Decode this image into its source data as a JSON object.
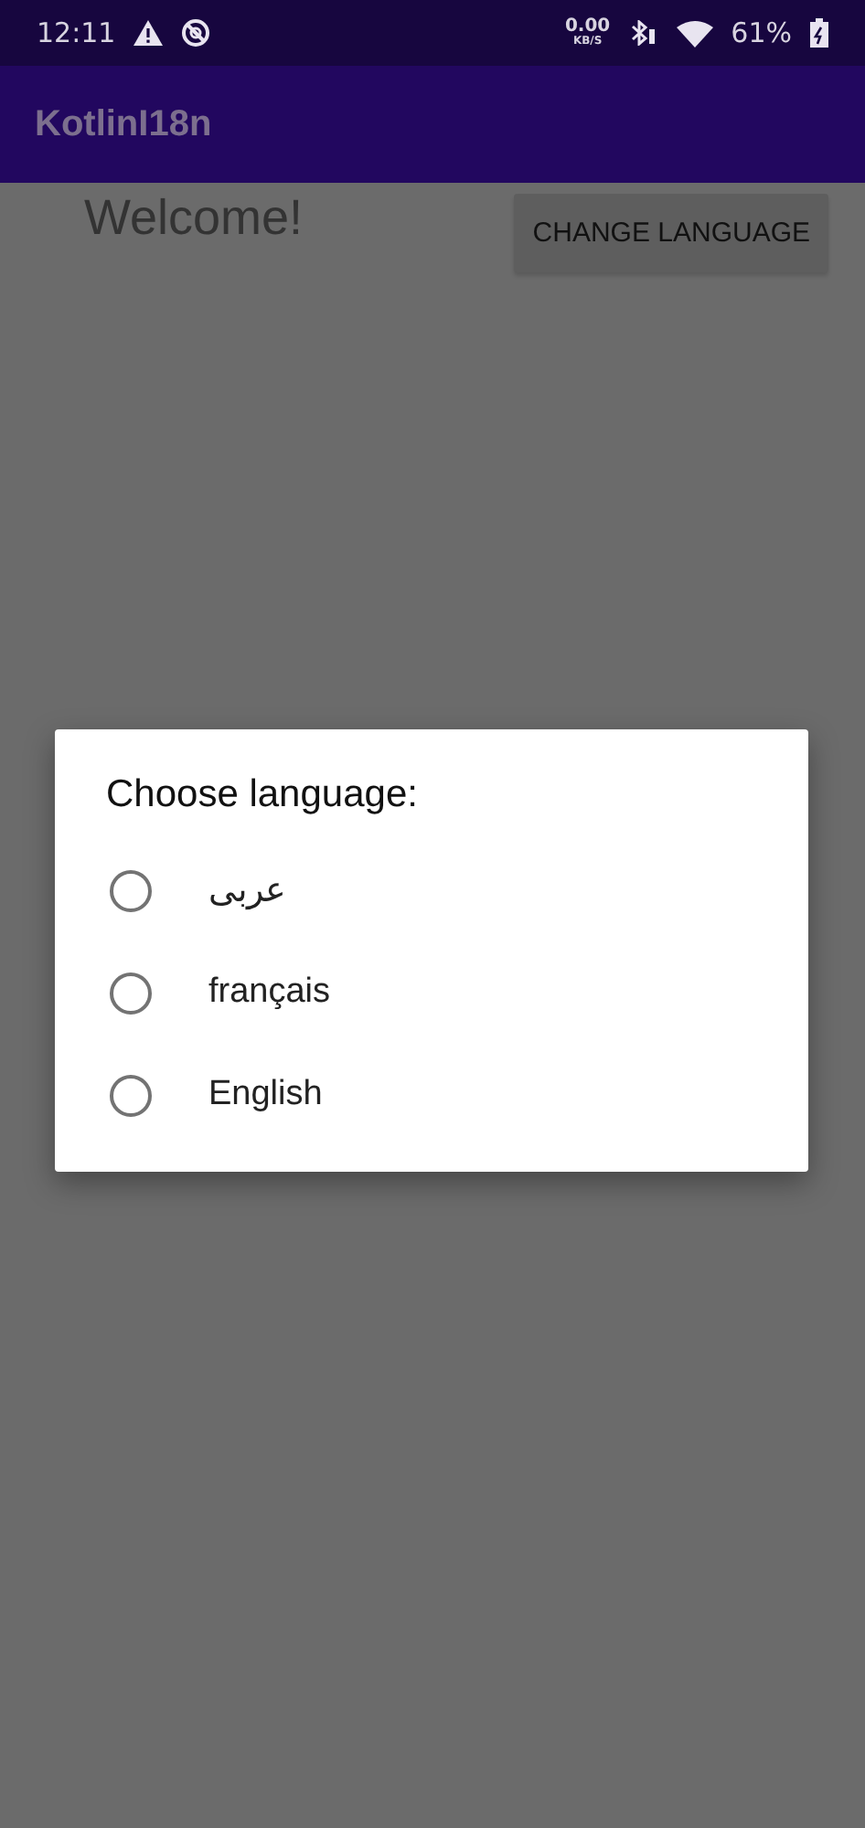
{
  "status_bar": {
    "time": "12:11",
    "speed_value": "0.00",
    "speed_unit": "KB/S",
    "battery": "61%"
  },
  "app_bar": {
    "title": "KotlinI18n"
  },
  "content": {
    "welcome": "Welcome!",
    "button": "CHANGE LANGUAGE"
  },
  "dialog": {
    "title": "Choose language:",
    "options": [
      {
        "label": "عربى",
        "selected": false
      },
      {
        "label": "français",
        "selected": false
      },
      {
        "label": "English",
        "selected": false
      }
    ]
  }
}
